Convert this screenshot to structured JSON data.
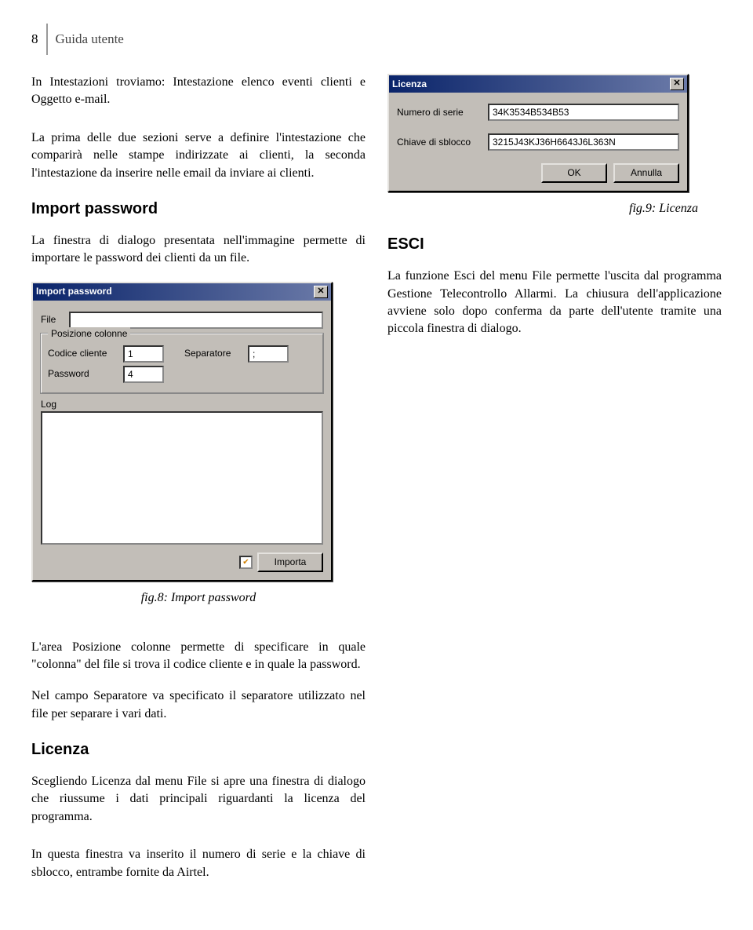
{
  "page": {
    "number": "8",
    "header": "Guida utente"
  },
  "left": {
    "p1": "In Intestazioni troviamo: Intestazione elenco eventi clienti e Oggetto e-mail.",
    "p2": "La prima delle due sezioni serve a definire l'intestazione che comparirà nelle stampe indirizzate ai clienti, la seconda l'intestazione da inserire nelle email da inviare ai clienti.",
    "h_import": "Import password",
    "p3": "La finestra di dialogo presentata nell'immagine permette di importare le password dei clienti da un file.",
    "fig8": "fig.8: Import password",
    "p4": "L'area Posizione colonne permette di specificare in quale \"colonna\" del file si trova il codice cliente e in quale la password.",
    "p5": "Nel campo Separatore va specificato il separatore utilizzato nel file per separare i vari dati.",
    "h_lic": "Licenza",
    "p6": "Scegliendo Licenza dal menu File si apre una finestra di dialogo che riussume i dati principali riguardanti la licenza del programma.",
    "p7": "In questa finestra va inserito il numero di serie e la chiave di sblocco, entrambe fornite da Airtel."
  },
  "right": {
    "fig9": "fig.9: Licenza",
    "h_esci": "ESCI",
    "p1": "La funzione Esci del menu File permette l'uscita dal programma Gestione Telecontrollo Allarmi. La chiusura dell'applicazione avviene solo dopo conferma da parte dell'utente tramite una piccola finestra di dialogo."
  },
  "dlg_lic": {
    "title": "Licenza",
    "lbl_serial": "Numero di serie",
    "val_serial": "34K3534B534B53",
    "lbl_key": "Chiave di sblocco",
    "val_key": "3215J43KJ36H6643J6L363N",
    "btn_ok": "OK",
    "btn_cancel": "Annulla"
  },
  "dlg_import": {
    "title": "Import password",
    "lbl_file": "File",
    "val_file": "",
    "group": "Posizione colonne",
    "lbl_code": "Codice cliente",
    "val_code": "1",
    "lbl_sep": "Separatore",
    "val_sep": ";",
    "lbl_pwd": "Password",
    "val_pwd": "4",
    "lbl_log": "Log",
    "btn_import": "Importa"
  }
}
